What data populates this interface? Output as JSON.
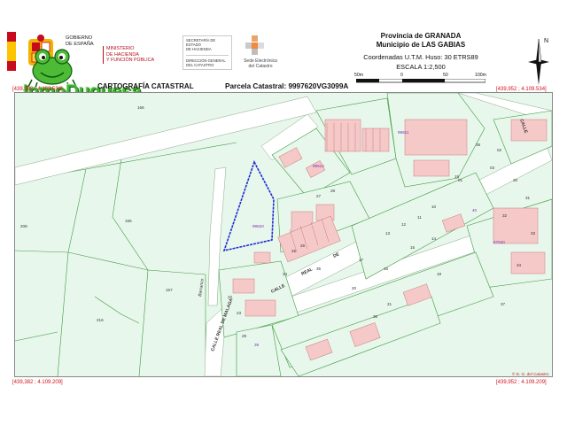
{
  "header": {
    "gov_lines": [
      "GOBIERNO",
      "DE ESPAÑA"
    ],
    "ministry_lines": [
      "MINISTERIO",
      "DE HACIENDA",
      "Y FUNCIÓN PÚBLICA"
    ],
    "secretaria_lines": [
      "SECRETARÍA DE ESTADO",
      "DE HACIENDA"
    ],
    "direccion_lines": [
      "DIRECCIÓN GENERAL",
      "DEL CATASTRO"
    ],
    "sede_lines": [
      "Sede Electrónica",
      "del Catastro"
    ],
    "provincia": "Provincia de GRANADA",
    "municipio": "Municipio de LAS GABIAS",
    "coordenadas": "Coordenadas U.T.M. Huso: 30 ETRS89",
    "escala": "ESCALA 1:2,500",
    "scale_ticks": [
      "50m",
      "0",
      "50",
      "100m"
    ],
    "north_label": "N",
    "watermark": "InmoDuquesa",
    "cartografia": "CARTOGRAFÍA CATASTRAL",
    "parcela": "Parcela Catastral: 9997620VG3099A"
  },
  "corners": {
    "top_left": "[439,382 ; 4.109.534]",
    "top_right": "[439,952 ; 4.109.534]",
    "bottom_left": "[439,382 ; 4.109.209]",
    "bottom_right": "[439,952 ; 4.109.209]"
  },
  "copyright": "© D. G. del Catastro",
  "map": {
    "street_labels": [
      "CALLE REAL DE MALAGA",
      "CALLE",
      "REAL",
      "DE",
      "CALLE",
      "Barranco"
    ],
    "parcel_numbers": [
      "166",
      "165",
      "208",
      "157",
      "216",
      "99611",
      "99612",
      "99620",
      "01",
      "02",
      "03",
      "10",
      "11",
      "12",
      "13",
      "14",
      "15",
      "16",
      "17",
      "18",
      "19",
      "20",
      "21",
      "22",
      "23",
      "24",
      "25",
      "26",
      "27",
      "28",
      "29",
      "30",
      "31",
      "32",
      "33",
      "34",
      "35",
      "36",
      "37",
      "38",
      "39",
      "40",
      "57940",
      "99960",
      "98581"
    ],
    "colors": {
      "background": "#e8f7ec",
      "building": "#f6c9c9",
      "parcel_line": "#3e9a3e",
      "road": "#ffffff",
      "highlight": "#1e2fd0",
      "label_purple": "#7a2fb5"
    }
  }
}
